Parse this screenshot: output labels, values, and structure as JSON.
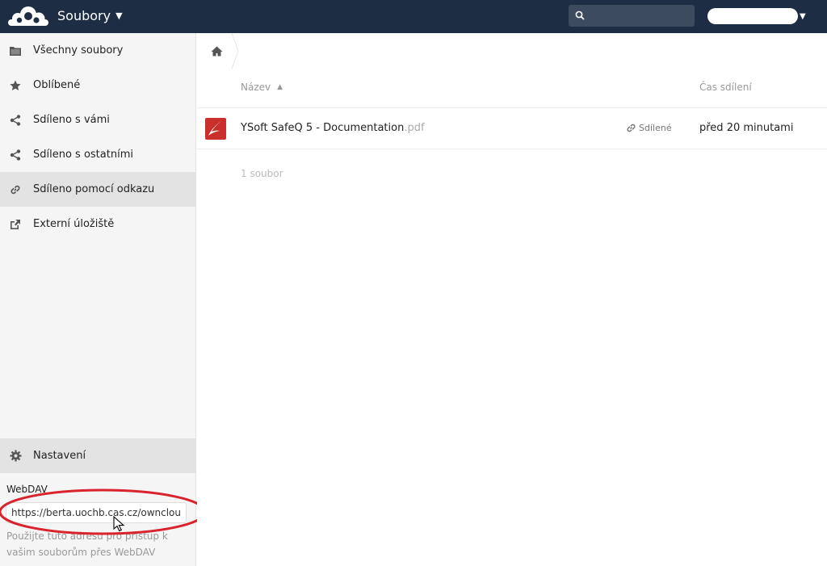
{
  "header": {
    "app_title": "Soubory",
    "bg_color": "#1d2d44",
    "search": {
      "value": "",
      "placeholder": ""
    },
    "user_name": ""
  },
  "sidebar": {
    "items": [
      {
        "label": "Všechny soubory",
        "icon": "folder-icon"
      },
      {
        "label": "Oblíbené",
        "icon": "star-icon"
      },
      {
        "label": "Sdíleno s vámi",
        "icon": "share-icon"
      },
      {
        "label": "Sdíleno s ostatními",
        "icon": "share-icon"
      },
      {
        "label": "Sdíleno pomocí odkazu",
        "icon": "link-icon",
        "active": true
      },
      {
        "label": "Externí úložiště",
        "icon": "external-storage-icon"
      }
    ],
    "settings": {
      "label": "Nastavení",
      "icon": "gear-icon"
    },
    "webdav": {
      "label": "WebDAV",
      "url": "https://berta.uochb.cas.cz/owncloud",
      "hint": "Použijte tuto adresu pro přístup k vašim souborům přes WebDAV"
    }
  },
  "main": {
    "columns": {
      "name": "Název",
      "shared_time": "Čas sdílení"
    },
    "files": [
      {
        "name": "YSoft SafeQ 5 - Documentation",
        "ext": ".pdf",
        "share_status": "Sdílené",
        "shared_time": "před 20 minutami",
        "icon": "pdf-file-icon"
      }
    ],
    "summary": "1 soubor"
  },
  "annotation": {
    "color": "#d9232d"
  }
}
